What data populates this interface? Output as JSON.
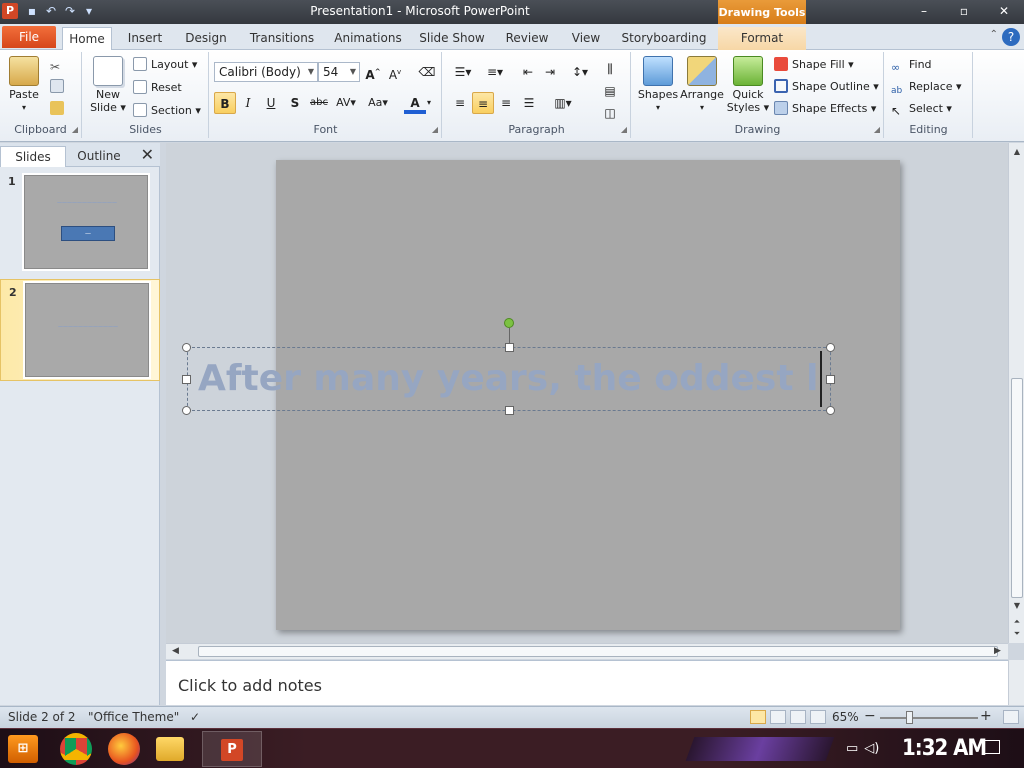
{
  "window": {
    "title": "Presentation1 - Microsoft PowerPoint",
    "contextual_tab": "Drawing Tools",
    "controls": [
      "–",
      "▫",
      "✕"
    ]
  },
  "tabs": [
    "File",
    "Home",
    "Insert",
    "Design",
    "Transitions",
    "Animations",
    "Slide Show",
    "Review",
    "View",
    "Storyboarding",
    "Format"
  ],
  "ribbon": {
    "clipboard": {
      "label": "Clipboard",
      "paste": "Paste"
    },
    "slides": {
      "label": "Slides",
      "new_slide_1": "New",
      "new_slide_2": "Slide ▾",
      "layout": "Layout ▾",
      "reset": "Reset",
      "section": "Section ▾"
    },
    "font": {
      "label": "Font",
      "name": "Calibri (Body)",
      "size": "54",
      "bold": "B",
      "italic": "I",
      "underline": "U",
      "shadow": "S",
      "strike": "abc",
      "spacing": "AV▾",
      "case": "Aa▾",
      "color": "A"
    },
    "paragraph": {
      "label": "Paragraph"
    },
    "drawing": {
      "label": "Drawing",
      "shapes": "Shapes",
      "arrange": "Arrange",
      "quick_styles_1": "Quick",
      "quick_styles_2": "Styles ▾",
      "shape_fill": "Shape Fill ▾",
      "shape_outline": "Shape Outline ▾",
      "shape_effects": "Shape Effects ▾"
    },
    "editing": {
      "label": "Editing",
      "find": "Find",
      "replace": "Replace ▾",
      "select": "Select ▾"
    }
  },
  "left_pane": {
    "tabs": [
      "Slides",
      "Outline"
    ],
    "close": "✕",
    "slides": [
      {
        "num": "1",
        "title": "————————————",
        "box": "—"
      },
      {
        "num": "2",
        "title": "————————————"
      }
    ]
  },
  "slide": {
    "text": "After many years, the oddest la"
  },
  "notes": {
    "placeholder": "Click to add notes"
  },
  "status": {
    "slide_info": "Slide 2 of 2",
    "theme": "\"Office Theme\"",
    "zoom": "65%",
    "zoom_minus": "−",
    "zoom_plus": "+",
    "zoom_level": 0.3
  },
  "taskbar": {
    "start": "⊞",
    "ppt_icon": "P",
    "clock": "1:32 AM"
  },
  "colors": {
    "accent": "#d24726",
    "slide_bg": "#a8a8a8",
    "text": "#96a6c2"
  }
}
